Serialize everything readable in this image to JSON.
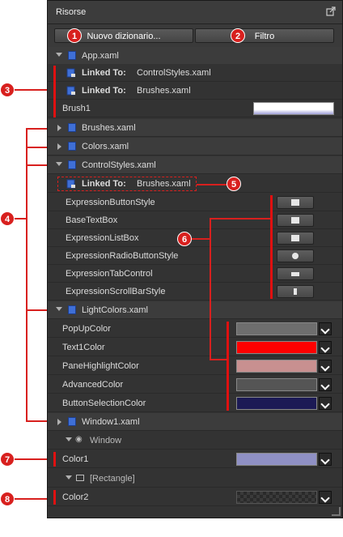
{
  "panel": {
    "title": "Risorse",
    "buttons": {
      "new_dictionary": "Nuovo dizionario...",
      "filter": "Filtro"
    }
  },
  "callouts": [
    "1",
    "2",
    "3",
    "4",
    "5",
    "6",
    "7",
    "8"
  ],
  "tree": {
    "app": {
      "label": "App.xaml",
      "linked_prefix": "Linked To:",
      "linked1": "ControlStyles.xaml",
      "linked2": "Brushes.xaml",
      "brush1_label": "Brush1"
    },
    "brushes": "Brushes.xaml",
    "colors": "Colors.xaml",
    "controlstyles": {
      "label": "ControlStyles.xaml",
      "linked_prefix": "Linked To:",
      "linked": "Brushes.xaml",
      "styles": [
        "ExpressionButtonStyle",
        "BaseTextBox",
        "ExpressionListBox",
        "ExpressionRadioButtonStyle",
        "ExpressionTabControl",
        "ExpressionScrollBarStyle"
      ]
    },
    "lightcolors": {
      "label": "LightColors.xaml",
      "colors": [
        {
          "name": "PopUpColor",
          "color": "#6e6e6e"
        },
        {
          "name": "Text1Color",
          "color": "#ff0000"
        },
        {
          "name": "PaneHighlightColor",
          "color": "#c89090"
        },
        {
          "name": "AdvancedColor",
          "color": "#555555"
        },
        {
          "name": "ButtonSelectionColor",
          "color": "#1c1a55"
        }
      ]
    },
    "window1": {
      "label": "Window1.xaml",
      "window_label": "Window",
      "color1_label": "Color1",
      "color1_value": "#8f90c4",
      "rectangle_label": "[Rectangle]",
      "color2_label": "Color2"
    }
  },
  "accent": "#d8201e"
}
